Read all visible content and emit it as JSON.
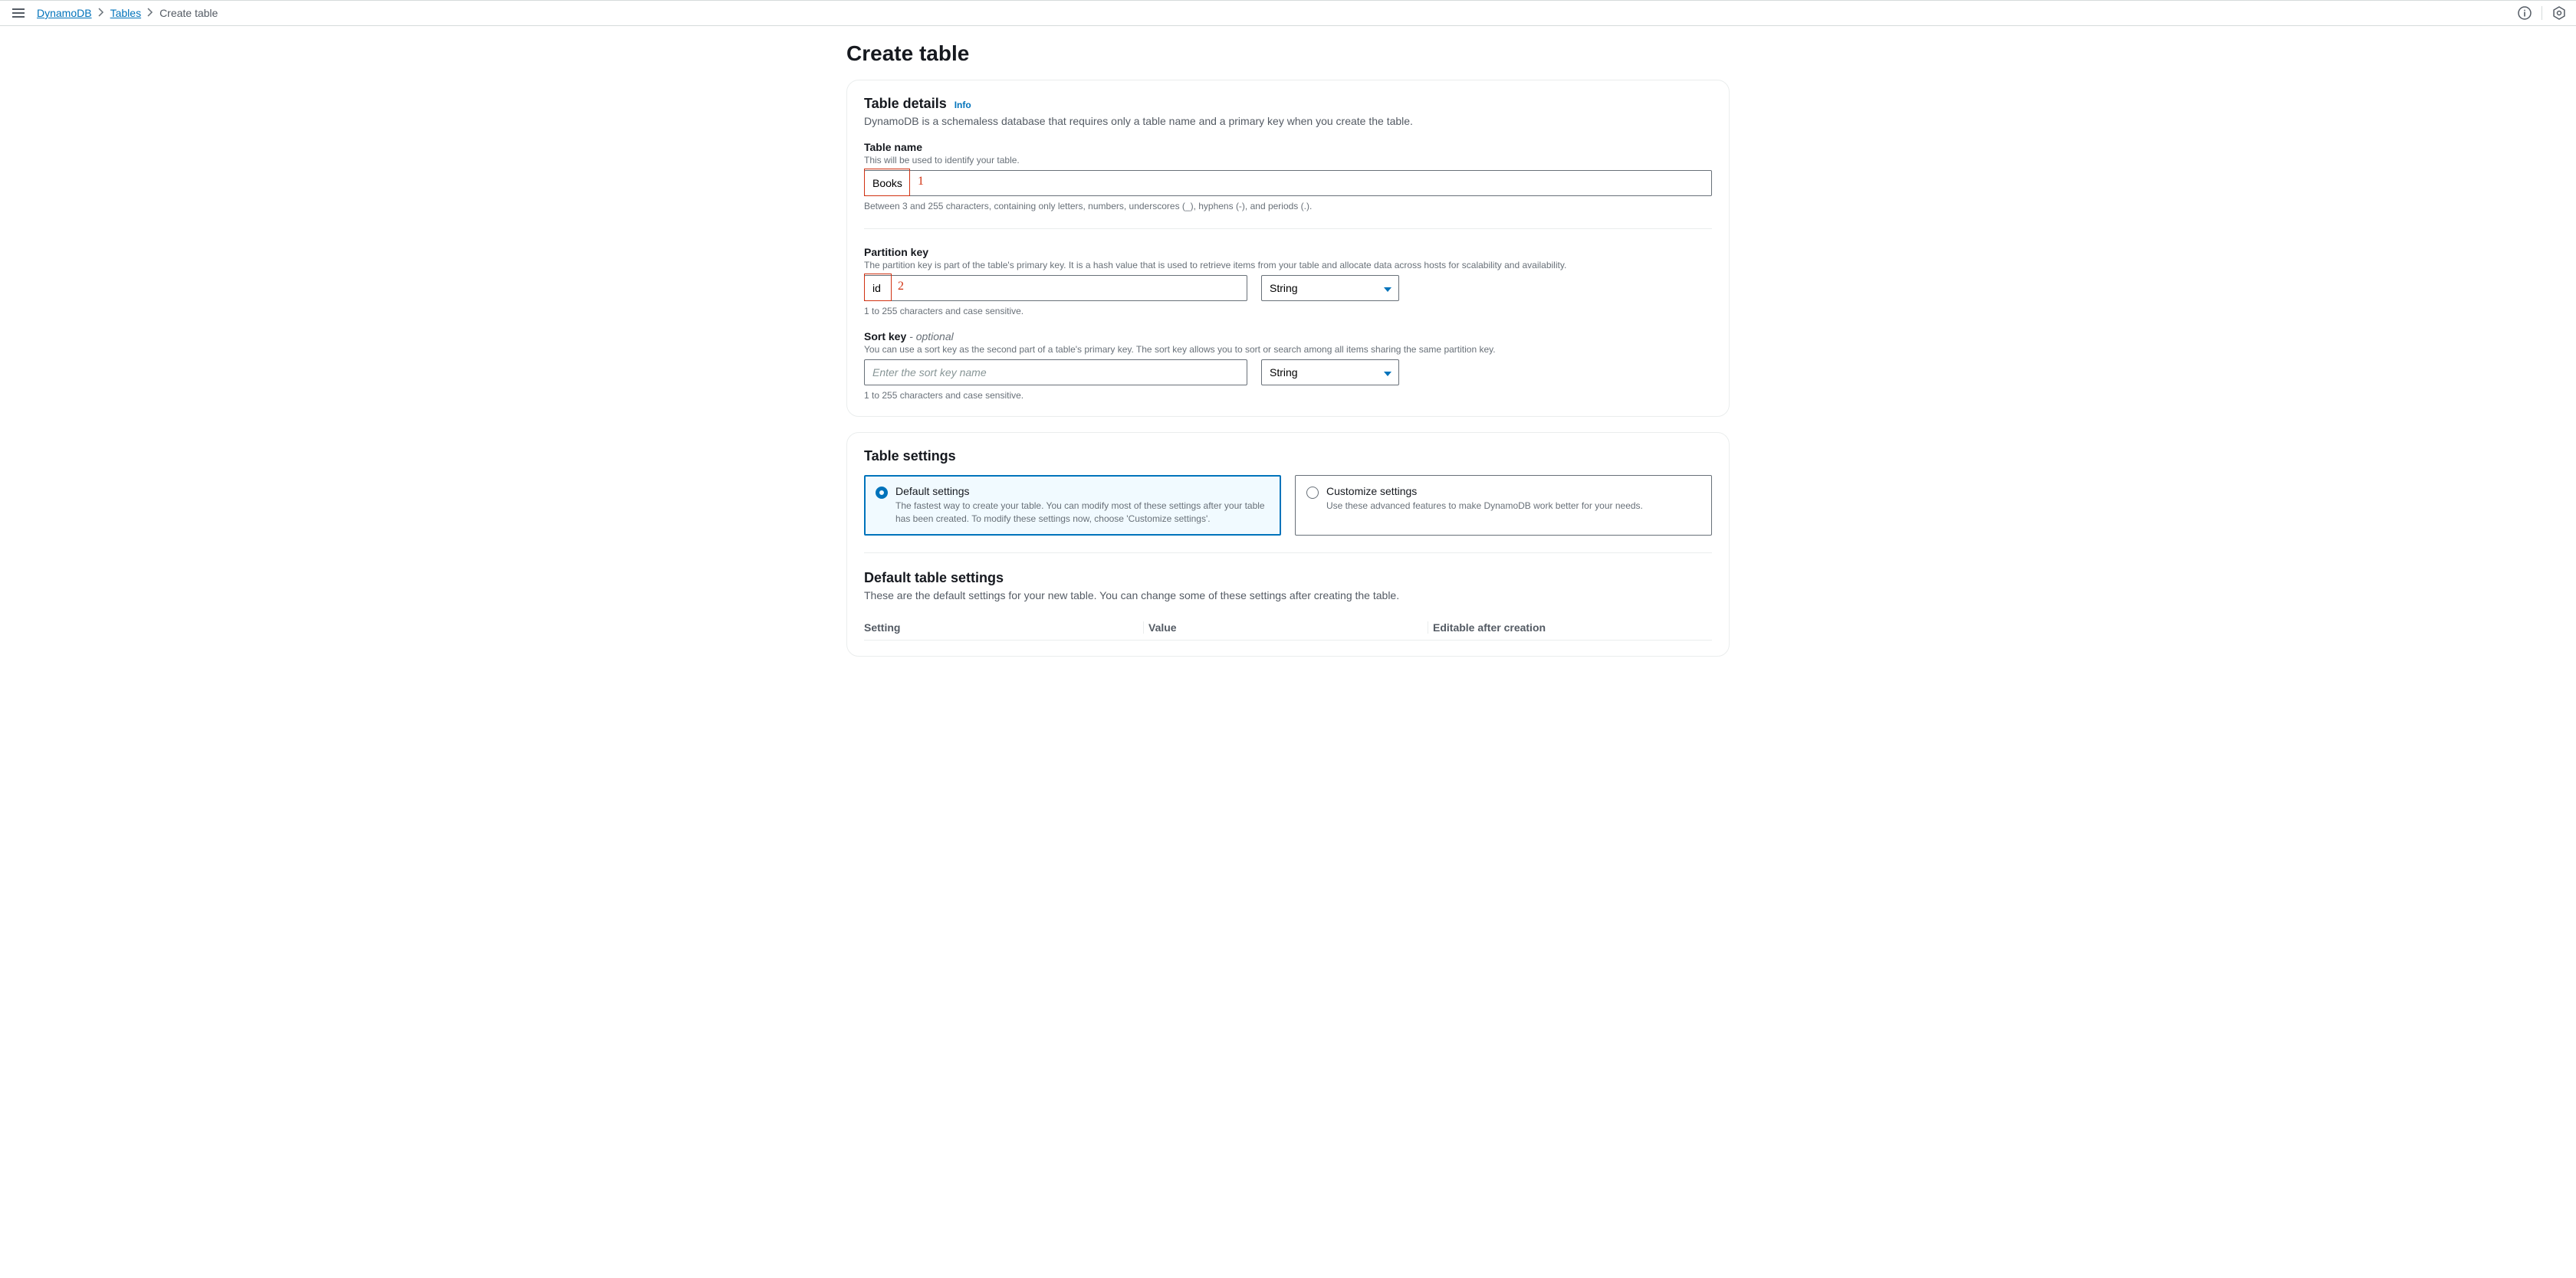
{
  "breadcrumb": {
    "root": "DynamoDB",
    "mid": "Tables",
    "current": "Create table"
  },
  "page_title": "Create table",
  "table_details": {
    "heading": "Table details",
    "info": "Info",
    "desc": "DynamoDB is a schemaless database that requires only a table name and a primary key when you create the table.",
    "table_name": {
      "label": "Table name",
      "hint": "This will be used to identify your table.",
      "value": "Books",
      "constraint": "Between 3 and 255 characters, containing only letters, numbers, underscores (_), hyphens (-), and periods (.)."
    },
    "partition_key": {
      "label": "Partition key",
      "hint": "The partition key is part of the table's primary key. It is a hash value that is used to retrieve items from your table and allocate data across hosts for scalability and availability.",
      "value": "id",
      "type": "String",
      "constraint": "1 to 255 characters and case sensitive."
    },
    "sort_key": {
      "label": "Sort key",
      "optional": "- optional",
      "hint": "You can use a sort key as the second part of a table's primary key. The sort key allows you to sort or search among all items sharing the same partition key.",
      "placeholder": "Enter the sort key name",
      "type": "String",
      "constraint": "1 to 255 characters and case sensitive."
    }
  },
  "table_settings": {
    "heading": "Table settings",
    "default": {
      "title": "Default settings",
      "desc": "The fastest way to create your table. You can modify most of these settings after your table has been created. To modify these settings now, choose 'Customize settings'."
    },
    "customize": {
      "title": "Customize settings",
      "desc": "Use these advanced features to make DynamoDB work better for your needs."
    }
  },
  "default_table_settings": {
    "heading": "Default table settings",
    "desc": "These are the default settings for your new table. You can change some of these settings after creating the table.",
    "columns": {
      "setting": "Setting",
      "value": "Value",
      "editable": "Editable after creation"
    }
  },
  "annotations": {
    "one": "1",
    "two": "2"
  }
}
